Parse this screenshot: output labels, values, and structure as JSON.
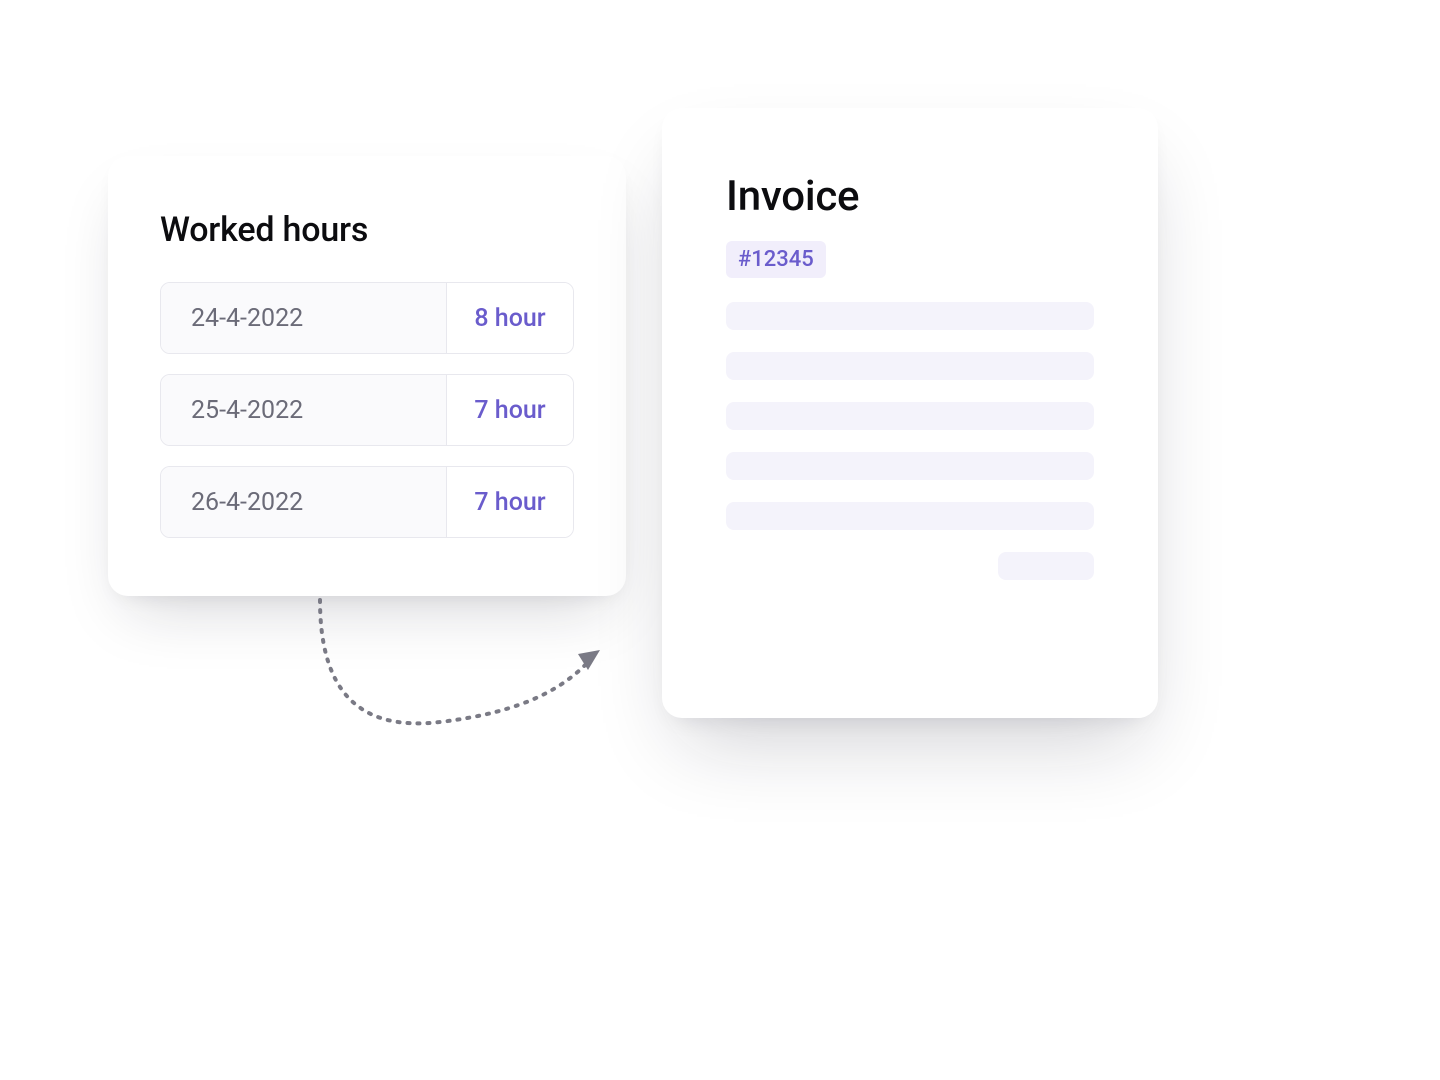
{
  "hours_card": {
    "title": "Worked hours",
    "rows": [
      {
        "date": "24-4-2022",
        "hours": "8 hour"
      },
      {
        "date": "25-4-2022",
        "hours": "7 hour"
      },
      {
        "date": "26-4-2022",
        "hours": "7 hour"
      }
    ]
  },
  "invoice_card": {
    "title": "Invoice",
    "number": "#12345"
  }
}
